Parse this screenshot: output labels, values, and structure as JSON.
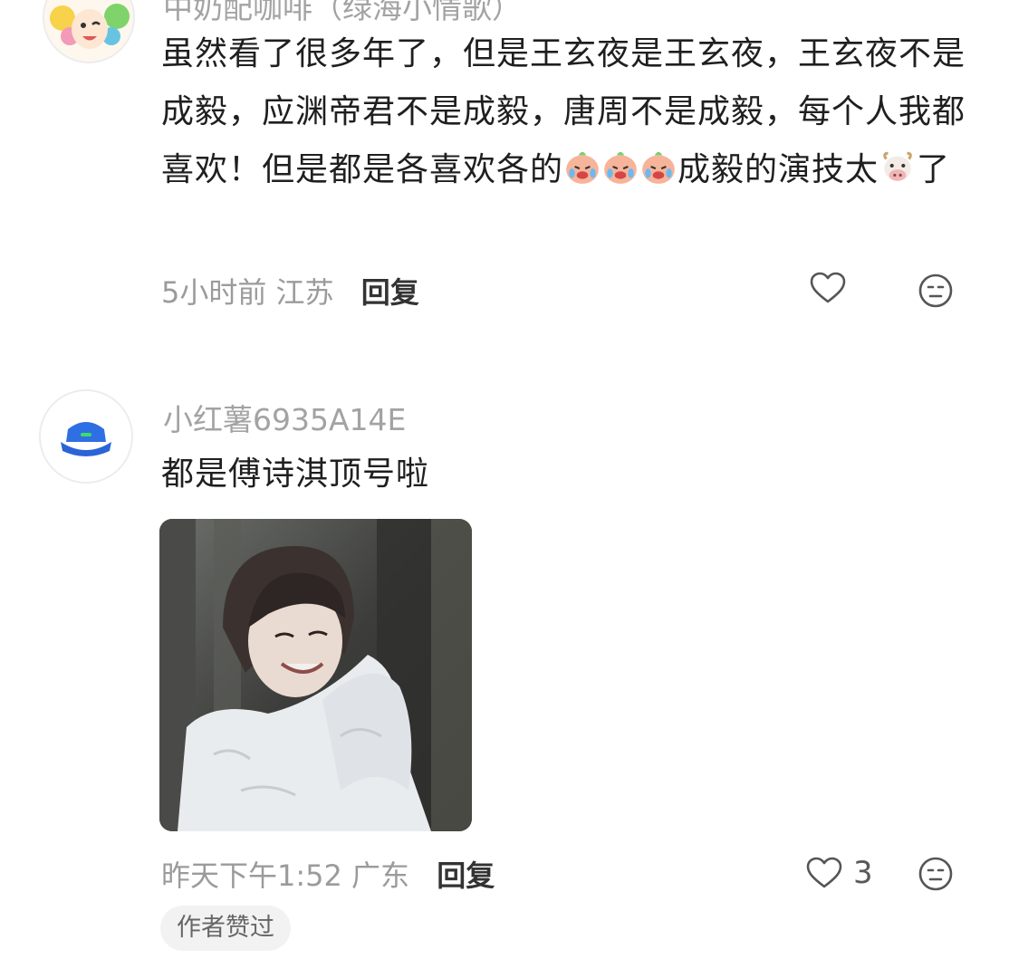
{
  "comments": [
    {
      "username": "中奶配咖啡（绿海小情歌）",
      "text_parts": {
        "p1": "虽然看了很多年了，但是王玄夜是王玄夜，王玄夜不是成毅，应渊帝君不是成毅，唐周不是成毅，每个人我都喜欢！但是都是各喜欢各的",
        "p2": "成毅的演技太",
        "p3": "了"
      },
      "emoji": [
        "crying-peach-emoji",
        "crying-peach-emoji",
        "crying-peach-emoji",
        "cow-emoji"
      ],
      "time": "5小时前",
      "location": "江苏",
      "reply_label": "回复",
      "likes": ""
    },
    {
      "username": "小红薯6935A14E",
      "text": "都是傅诗淇顶号啦",
      "image": "photo of smiling man in white robe",
      "time": "昨天下午1:52",
      "location": "广东",
      "reply_label": "回复",
      "likes": "3",
      "badge": "作者赞过"
    }
  ],
  "colors": {
    "secondary_text": "#9b9b9b",
    "badge_bg": "#f2f2f2",
    "avatar_hat": "#2f6fe4"
  }
}
